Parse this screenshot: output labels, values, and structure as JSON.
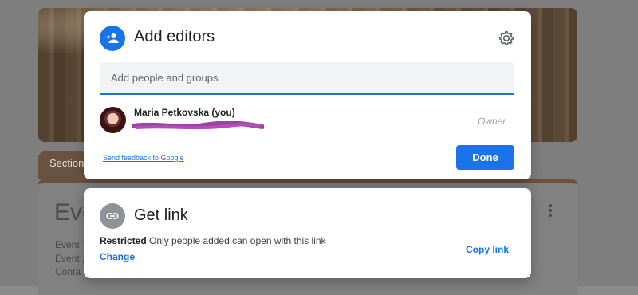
{
  "background_form": {
    "section_label": "Section",
    "form_title": "Eve",
    "fields": [
      "Event T",
      "Event ,",
      "Conta"
    ]
  },
  "editors_dialog": {
    "title": "Add editors",
    "search_placeholder": "Add people and groups",
    "user": {
      "name": "Maria Petkovska (you)",
      "role": "Owner"
    },
    "feedback_link": "Send feedback to Google",
    "done_label": "Done"
  },
  "link_dialog": {
    "title": "Get link",
    "restriction_label": "Restricted",
    "restriction_text": "Only people added can open with this link",
    "change_label": "Change",
    "copy_label": "Copy link"
  },
  "colors": {
    "accent": "#1a73e8",
    "link_icon_bg": "#8d9398",
    "redaction": "#a23ea7"
  },
  "icons": [
    "add-person-icon",
    "gear-icon",
    "link-icon",
    "more-vertical-icon"
  ]
}
